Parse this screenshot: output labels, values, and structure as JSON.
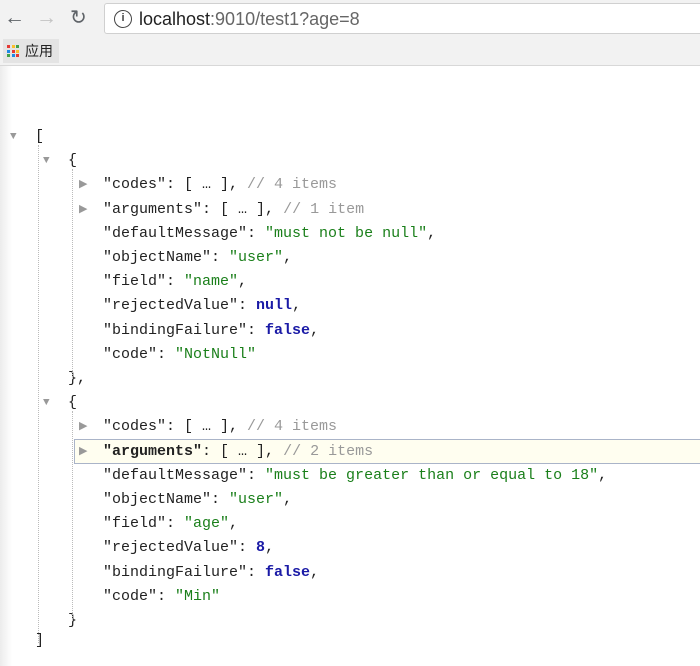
{
  "browser": {
    "url_host": "localhost",
    "url_rest": ":9010/test1?age=8",
    "apps_label": "应用"
  },
  "json_view": {
    "open_array": "[",
    "close_array": "]",
    "objects": [
      {
        "open": "{",
        "close": "},",
        "lines": [
          {
            "type": "collapsed",
            "key": "codes",
            "summary": "[ … ],",
            "comment": "// 4 items"
          },
          {
            "type": "collapsed",
            "key": "arguments",
            "summary": "[ … ],",
            "comment": "// 1 item"
          },
          {
            "type": "string",
            "key": "defaultMessage",
            "value": "\"must not be null\"",
            "tail": ","
          },
          {
            "type": "string",
            "key": "objectName",
            "value": "\"user\"",
            "tail": ","
          },
          {
            "type": "string",
            "key": "field",
            "value": "\"name\"",
            "tail": ","
          },
          {
            "type": "keyword",
            "key": "rejectedValue",
            "value": "null",
            "tail": ","
          },
          {
            "type": "keyword",
            "key": "bindingFailure",
            "value": "false",
            "tail": ","
          },
          {
            "type": "string",
            "key": "code",
            "value": "\"NotNull\"",
            "tail": ""
          }
        ]
      },
      {
        "open": "{",
        "close": "}",
        "lines": [
          {
            "type": "collapsed",
            "key": "codes",
            "summary": "[ … ],",
            "comment": "// 4 items"
          },
          {
            "type": "collapsed",
            "key": "arguments",
            "summary": "[ … ],",
            "comment": "// 2 items",
            "highlighted": true
          },
          {
            "type": "string",
            "key": "defaultMessage",
            "value": "\"must be greater than or equal to 18\"",
            "tail": ","
          },
          {
            "type": "string",
            "key": "objectName",
            "value": "\"user\"",
            "tail": ","
          },
          {
            "type": "string",
            "key": "field",
            "value": "\"age\"",
            "tail": ","
          },
          {
            "type": "keyword",
            "key": "rejectedValue",
            "value": "8",
            "tail": ","
          },
          {
            "type": "keyword",
            "key": "bindingFailure",
            "value": "false",
            "tail": ","
          },
          {
            "type": "string",
            "key": "code",
            "value": "\"Min\"",
            "tail": ""
          }
        ]
      }
    ]
  },
  "colors": {
    "string": "#1a7f1a",
    "keyword": "#1a1aa6",
    "comment": "#999999",
    "highlight_bg": "#fffef0"
  }
}
